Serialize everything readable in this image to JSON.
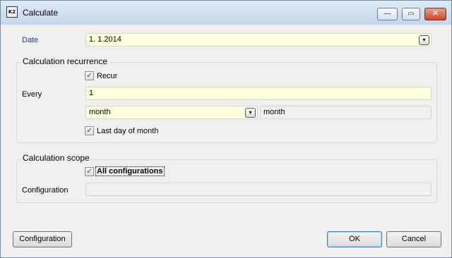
{
  "window": {
    "title": "Calculate",
    "icon_text": "K2",
    "minimize_glyph": "—",
    "maximize_glyph": "▭",
    "close_glyph": "✕"
  },
  "date": {
    "label": "Date",
    "value": "1. 1.2014",
    "dropdown_glyph": "▾"
  },
  "recurrence": {
    "title": "Calculation recurrence",
    "recur_label": "Recur",
    "recur_checked": true,
    "every_label": "Every",
    "every_value": "1",
    "unit_value": "month",
    "unit_dropdown_glyph": "▾",
    "unit_display": "month",
    "last_day_label": "Last day of month",
    "last_day_checked": true
  },
  "scope": {
    "title": "Calculation scope",
    "all_configs_label": "All configurations",
    "all_configs_checked": true,
    "configuration_label": "Configuration",
    "configuration_value": ""
  },
  "buttons": {
    "configuration": "Configuration",
    "ok": "OK",
    "cancel": "Cancel"
  },
  "check_glyph": "✓",
  "colors": {
    "field_bg": "#ffffde",
    "label_blue": "#1a3c9a",
    "titlebar": "#c5d7ea"
  }
}
